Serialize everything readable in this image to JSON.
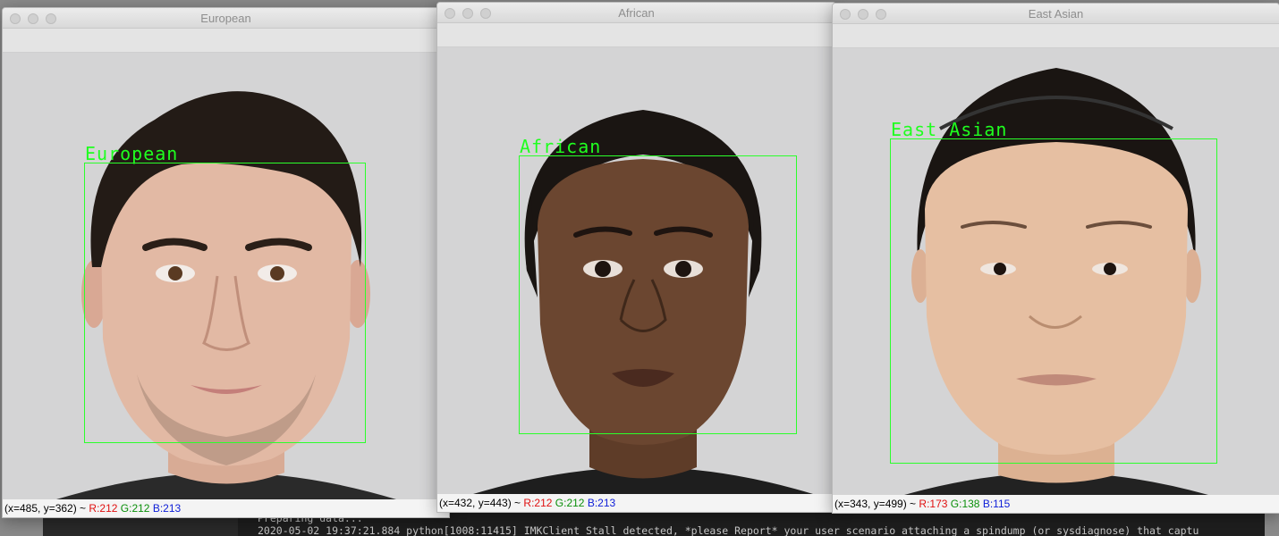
{
  "terminal": {
    "lines": [
      "Preparing data...",
      "2020-05-02 19:37:21.884 python[1008:11415] IMKClient Stall detected, *please Report* your user scenario attaching a spindump (or sysdiagnose) that captu"
    ]
  },
  "windows": [
    {
      "title": "European",
      "label": "European",
      "status": {
        "coords": "(x=485, y=362) ~",
        "r": "R:212",
        "g": "G:212",
        "b": "B:213"
      }
    },
    {
      "title": "African",
      "label": "African",
      "status": {
        "coords": "(x=432, y=443) ~",
        "r": "R:212",
        "g": "G:212",
        "b": "B:213"
      }
    },
    {
      "title": "East Asian",
      "label": "East Asian",
      "status": {
        "coords": "(x=343, y=499) ~",
        "r": "R:173",
        "g": "G:138",
        "b": "B:115"
      }
    }
  ],
  "colors": {
    "bbox": "#2bff2b",
    "skin_european": "#e2b9a4",
    "skin_african": "#6b4630",
    "skin_east_asian": "#e6bfa2",
    "hair": "#1c1714",
    "background": "#d4d4d5"
  }
}
